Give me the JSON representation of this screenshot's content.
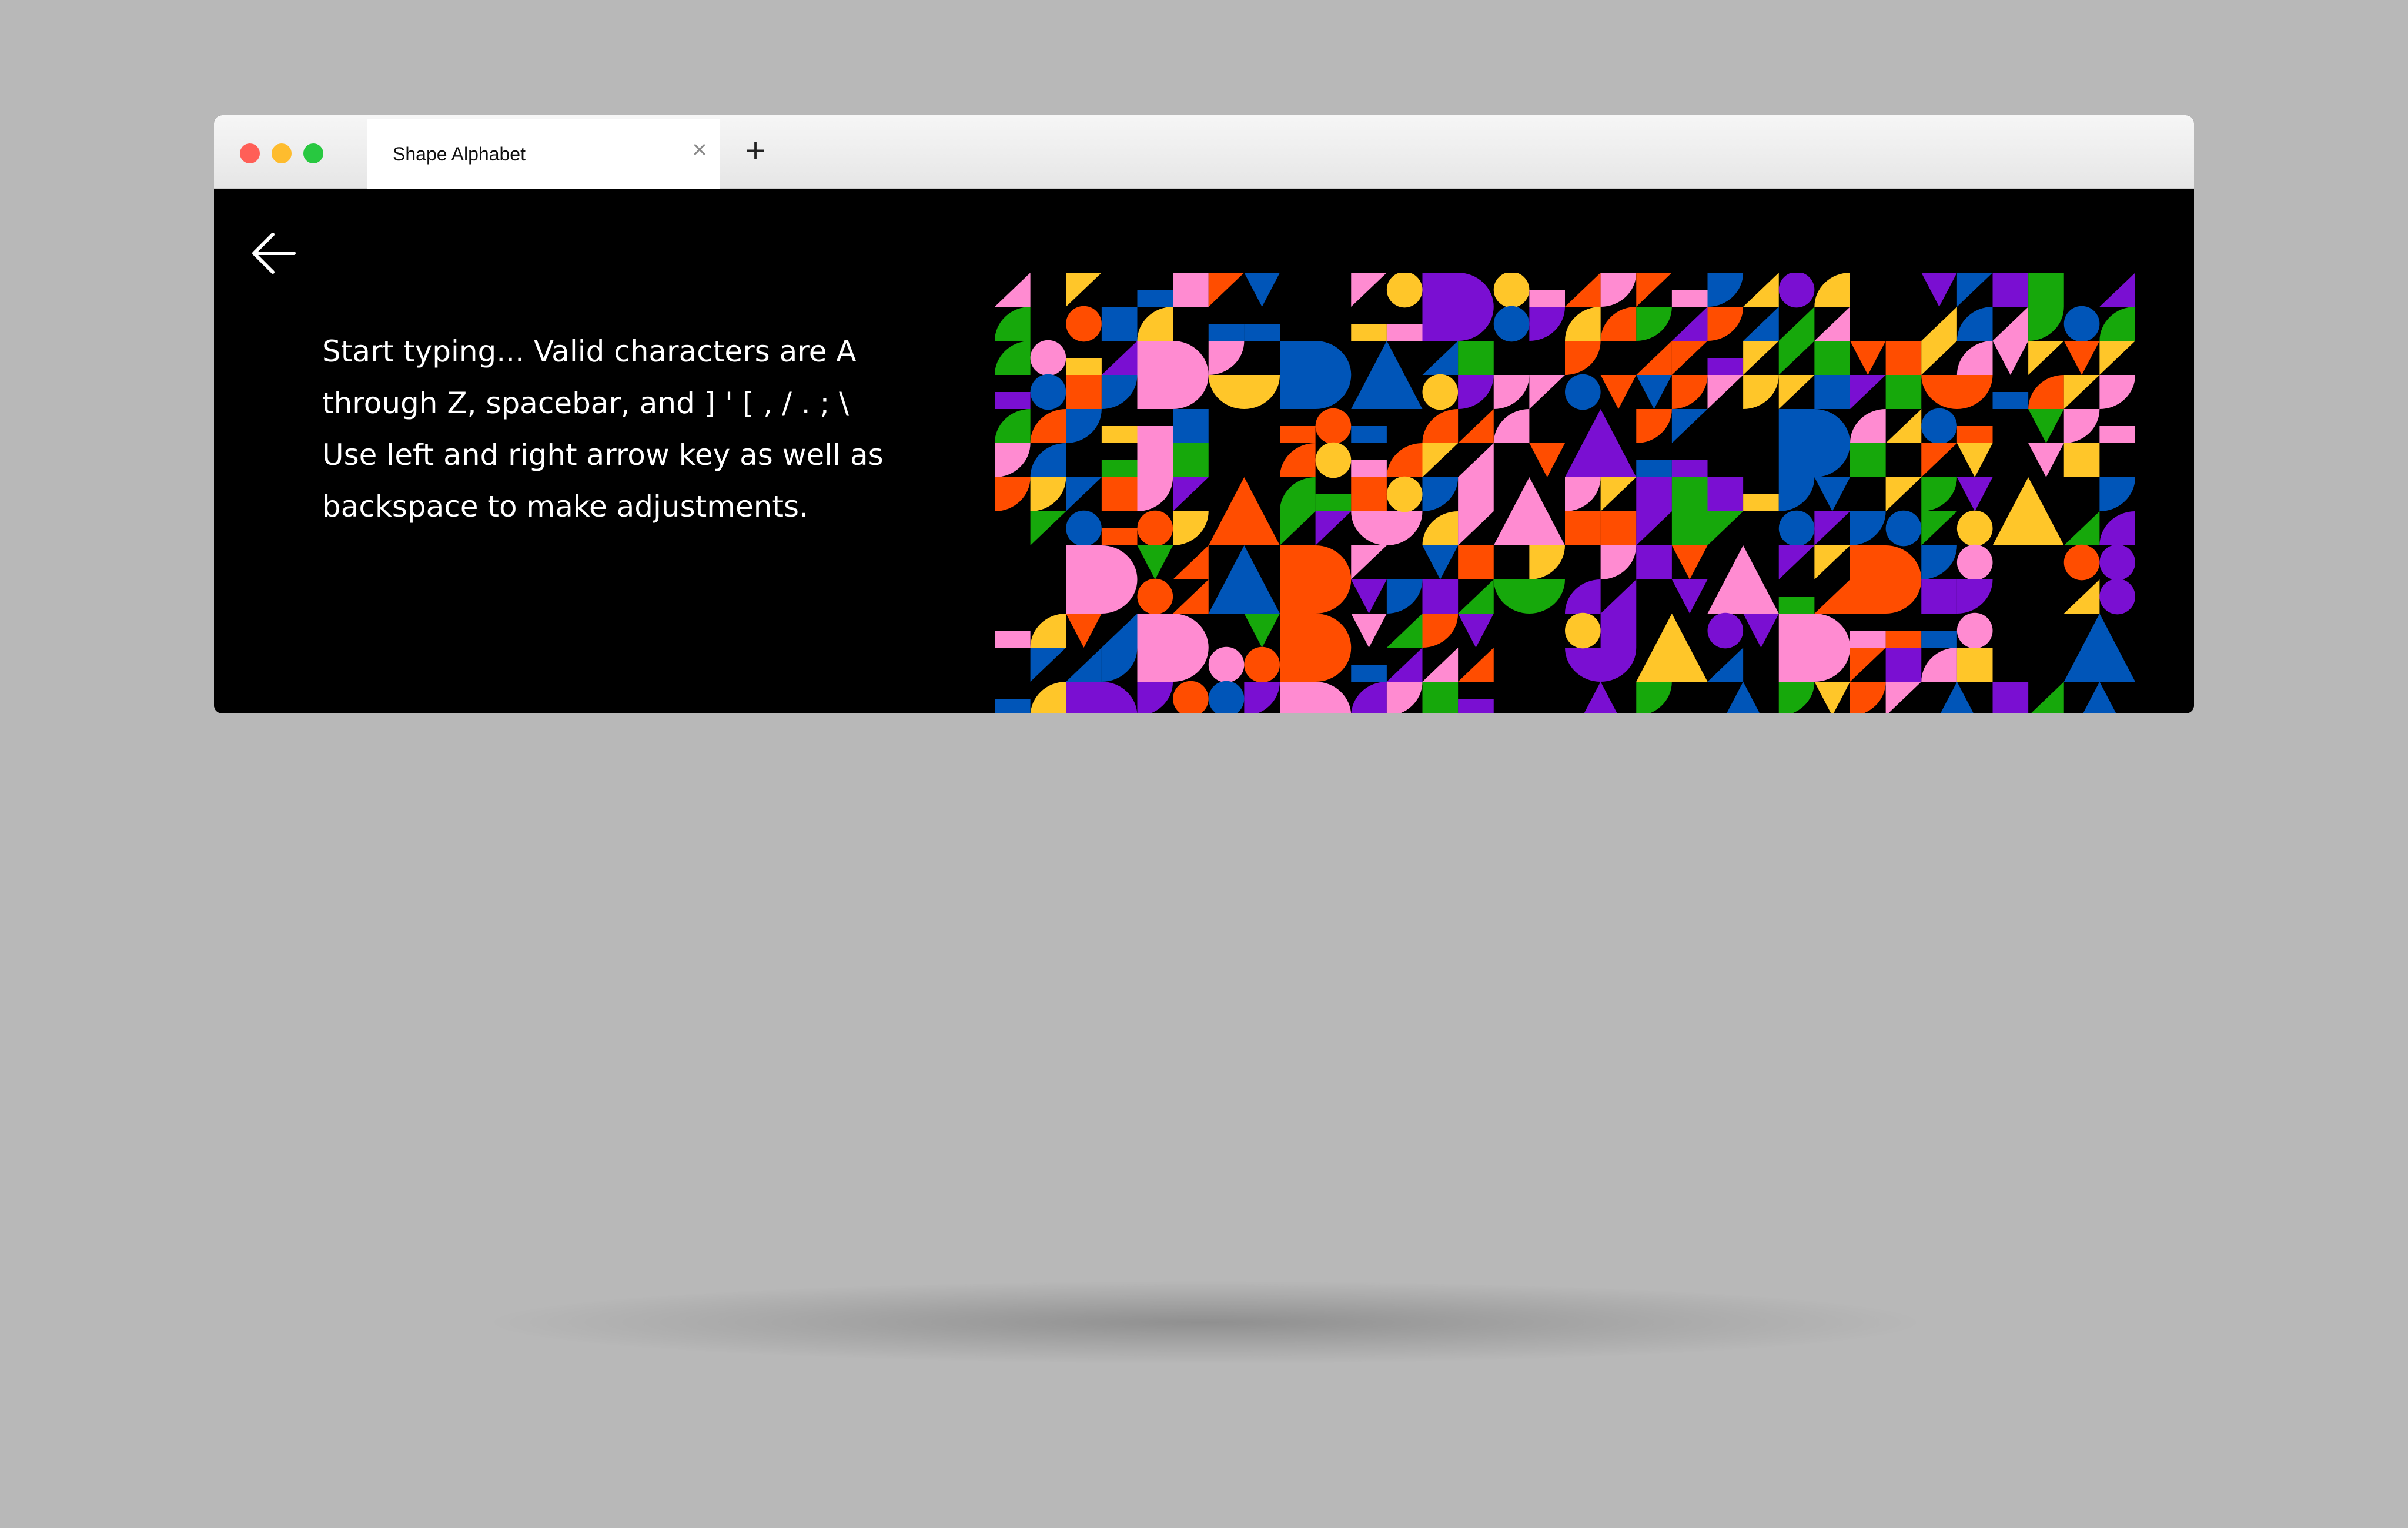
{
  "browser": {
    "tab_title": "Shape Alphabet",
    "tab_close": "×",
    "new_tab": "+"
  },
  "page": {
    "back_icon": "arrow-left-icon",
    "instructions": [
      "Start typing... Valid characters are A",
      "through Z, spacebar, and ] ' [ , / . ; \\",
      "Use left and right arrow key as well as",
      "backspace to make adjustments."
    ]
  },
  "palette": {
    "orange": "#ff4d00",
    "yellow": "#ffc629",
    "purple": "#7a0fd2",
    "pink": "#ff8bd1",
    "blue": "#0055b8",
    "green": "#16a80b",
    "black": "#000000"
  }
}
